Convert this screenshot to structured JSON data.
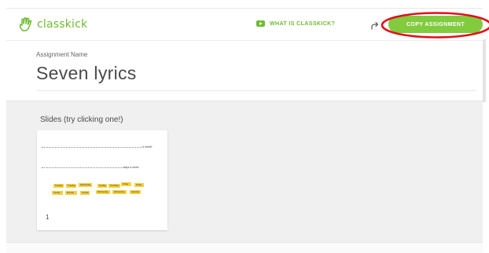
{
  "header": {
    "brand": "classkick",
    "what_is_link": "WHAT IS CLASSKICK?",
    "copy_button": "COPY ASSIGNMENT",
    "accent_color": "#82cb3f",
    "highlight_color": "#e0101a",
    "icons": [
      "classkick-hand-logo",
      "youtube-play-icon",
      "share-icon"
    ]
  },
  "assignment": {
    "name_label": "Assignment Name",
    "title": "Seven lyrics"
  },
  "slides": {
    "heading": "Slides (try clicking one!)",
    "items": [
      {
        "number": "1",
        "line1_suffix": "'s week!",
        "line2_suffix": "days a week",
        "tags_row1": [
          "Tuesday",
          "Tuesday",
          "Wednesday",
          "Sunday",
          "Thursday",
          "Friday",
          "Friday"
        ],
        "tags_row2": [
          "Sunday",
          "Monday",
          "Sunday",
          "Wednesday",
          "Wednesday",
          "Saturday"
        ]
      }
    ]
  }
}
